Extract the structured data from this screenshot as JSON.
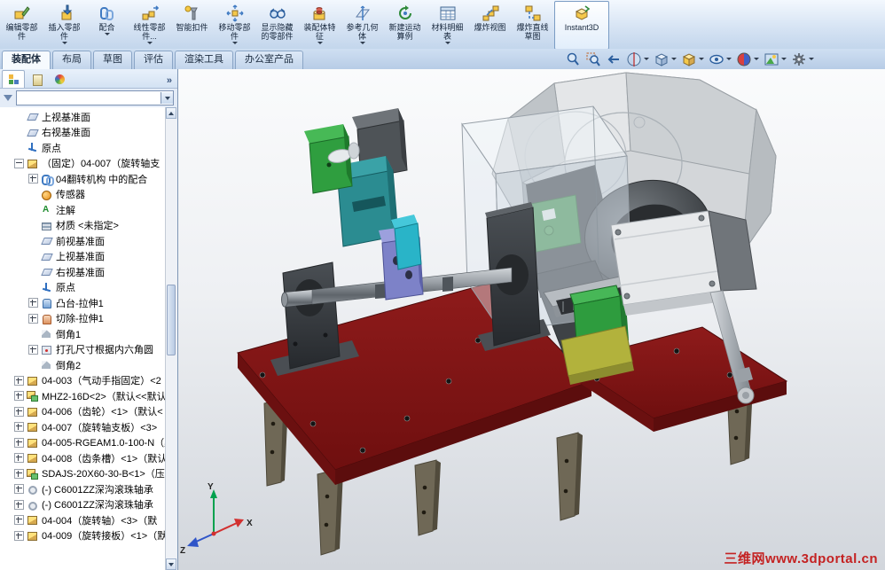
{
  "toolbar": {
    "buttons": [
      "编辑零部件",
      "插入零部件",
      "配合",
      "线性零部件...",
      "智能扣件",
      "移动零部件",
      "显示隐藏的零部件",
      "装配体特征",
      "参考几何体",
      "新建运动算例",
      "材料明细表",
      "爆炸视图",
      "爆炸直线草图",
      "Instant3D"
    ]
  },
  "ribbon_tabs": {
    "items": [
      "装配体",
      "布局",
      "草图",
      "评估",
      "渲染工具",
      "办公室产品"
    ],
    "active": "装配体"
  },
  "view_toolbar": {
    "icons": [
      "zoom-fit",
      "zoom-to-area",
      "previous-view",
      "section-view",
      "view-orientation",
      "display-style",
      "hide-show-items",
      "edit-appearance",
      "apply-scene",
      "view-settings"
    ]
  },
  "panel": {
    "tabs": [
      "featuremanager-tree",
      "propertymanager",
      "configurationmanager"
    ],
    "collapse_chevron": "»"
  },
  "feature_tree": {
    "items": [
      {
        "label": "上视基准面",
        "level": 1,
        "icon": "plane",
        "expander": ""
      },
      {
        "label": "右视基准面",
        "level": 1,
        "icon": "plane",
        "expander": ""
      },
      {
        "label": "原点",
        "level": 1,
        "icon": "origin",
        "expander": ""
      },
      {
        "label": "（固定）04-007（旋转轴支",
        "level": 1,
        "icon": "part",
        "expander": "minus"
      },
      {
        "label": "04翻转机构 中的配合",
        "level": 2,
        "icon": "mates",
        "expander": "plus"
      },
      {
        "label": "传感器",
        "level": 2,
        "icon": "sensor",
        "expander": ""
      },
      {
        "label": "注解",
        "level": 2,
        "icon": "annotations",
        "expander": ""
      },
      {
        "label": "材质 <未指定>",
        "level": 2,
        "icon": "material",
        "expander": ""
      },
      {
        "label": "前视基准面",
        "level": 2,
        "icon": "plane",
        "expander": ""
      },
      {
        "label": "上视基准面",
        "level": 2,
        "icon": "plane",
        "expander": ""
      },
      {
        "label": "右视基准面",
        "level": 2,
        "icon": "plane",
        "expander": ""
      },
      {
        "label": "原点",
        "level": 2,
        "icon": "origin",
        "expander": ""
      },
      {
        "label": "凸台-拉伸1",
        "level": 2,
        "icon": "boss",
        "expander": "plus"
      },
      {
        "label": "切除-拉伸1",
        "level": 2,
        "icon": "cut",
        "expander": "plus"
      },
      {
        "label": "倒角1",
        "level": 2,
        "icon": "chamfer",
        "expander": ""
      },
      {
        "label": "打孔尺寸根据内六角圆",
        "level": 2,
        "icon": "hole",
        "expander": "plus"
      },
      {
        "label": "倒角2",
        "level": 2,
        "icon": "chamfer",
        "expander": ""
      },
      {
        "label": "04-003（气动手指固定）<2",
        "level": 1,
        "icon": "part",
        "expander": "plus"
      },
      {
        "label": "MHZ2-16D<2>（默认<<默认",
        "level": 1,
        "icon": "assembly",
        "expander": "plus"
      },
      {
        "label": "04-006（齿轮）<1>（默认<",
        "level": 1,
        "icon": "part",
        "expander": "plus"
      },
      {
        "label": "04-007（旋转轴支板）<3>",
        "level": 1,
        "icon": "part",
        "expander": "plus"
      },
      {
        "label": "04-005-RGEAM1.0-100-N（默",
        "level": 1,
        "icon": "part",
        "expander": "plus"
      },
      {
        "label": "04-008（齿条槽）<1>（默认",
        "level": 1,
        "icon": "part",
        "expander": "plus"
      },
      {
        "label": "SDAJS-20X60-30-B<1>（压",
        "level": 1,
        "icon": "assembly",
        "expander": "plus"
      },
      {
        "label": "(-) C6001ZZ深沟滚珠轴承",
        "level": 1,
        "icon": "bearing",
        "expander": "plus"
      },
      {
        "label": "(-) C6001ZZ深沟滚珠轴承",
        "level": 1,
        "icon": "bearing",
        "expander": "plus"
      },
      {
        "label": "04-004（旋转轴）<3>（默",
        "level": 1,
        "icon": "part",
        "expander": "plus"
      },
      {
        "label": "04-009（旋转接板）<1>（默",
        "level": 1,
        "icon": "part",
        "expander": "plus"
      }
    ]
  },
  "viewport": {
    "watermark": "三维网www.3dportal.cn",
    "triad": {
      "x": "X",
      "y": "Y",
      "z": "Z"
    }
  },
  "colors": {
    "base_plate": "#7e1212",
    "teal_part": "#2b8c91",
    "green_part": "#2f9e3f",
    "purple_part": "#7d82c8",
    "watermark": "#cc2222"
  }
}
